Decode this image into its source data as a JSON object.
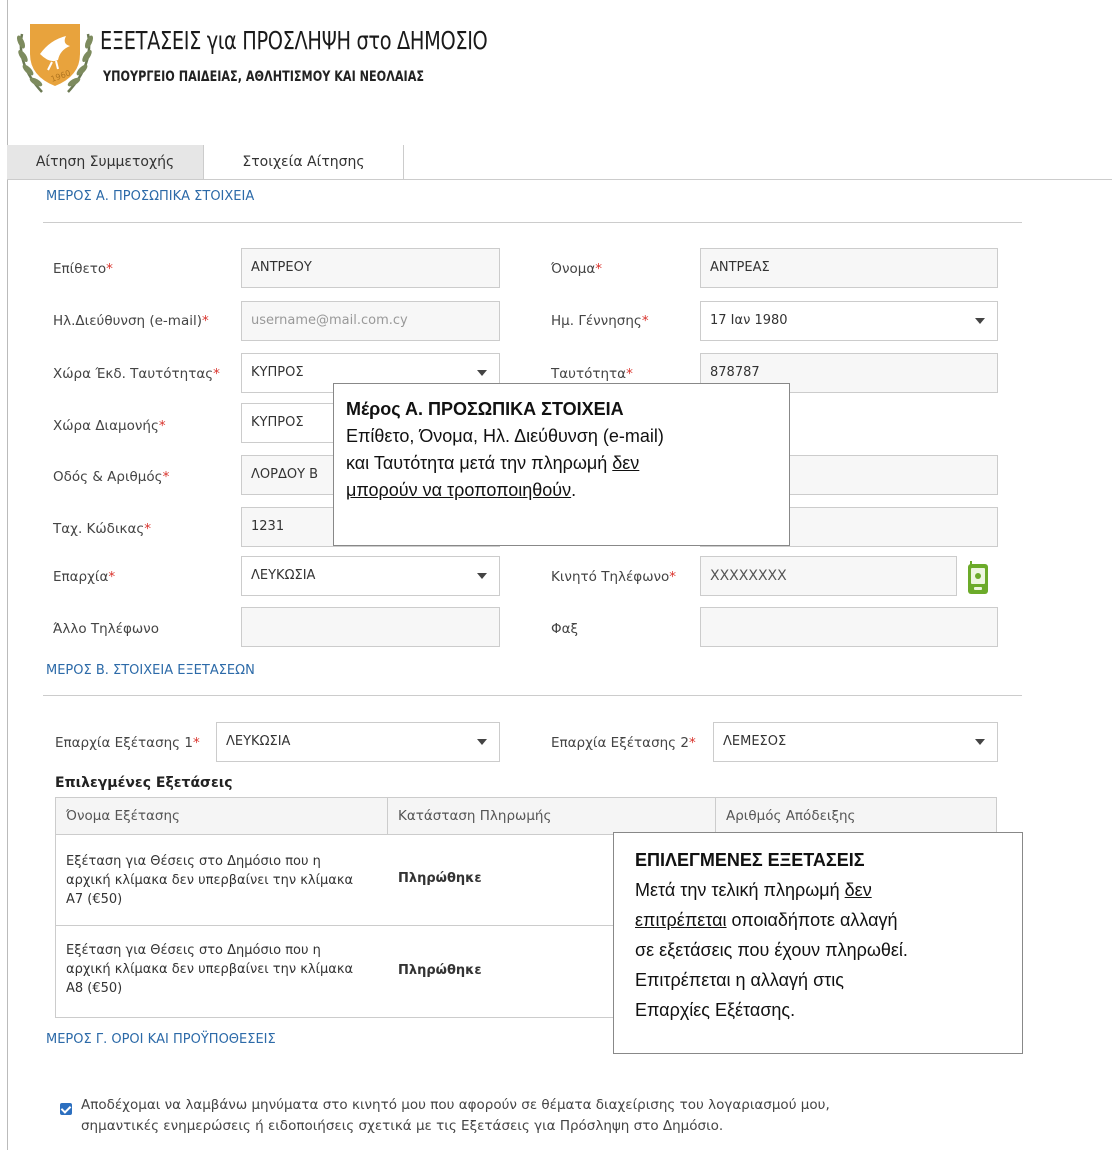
{
  "header": {
    "title": "ΕΞΕΤΑΣΕΙΣ για ΠΡΟΣΛΗΨΗ στο ΔΗΜΟΣΙΟ",
    "subtitle": "ΥΠΟΥΡΓΕΙΟ ΠΑΙΔΕΙΑΣ, ΑΘΛΗΤΙΣΜΟΥ ΚΑΙ ΝΕΟΛΑΙΑΣ"
  },
  "tabs": [
    {
      "label": "Αίτηση Συμμετοχής"
    },
    {
      "label": "Στοιχεία Αίτησης"
    }
  ],
  "section_a": {
    "title": "ΜΕΡΟΣ Α. ΠΡΟΣΩΠΙΚΑ ΣΤΟΙΧΕΙΑ",
    "fields": {
      "surname": {
        "label": "Επίθετο",
        "value": "ΑΝΤΡΕΟΥ"
      },
      "name": {
        "label": "Όνομα",
        "value": "ΑΝΤΡΕΑΣ"
      },
      "email": {
        "label": "Ηλ.Διεύθυνση (e-mail)",
        "value": "username@mail.com.cy"
      },
      "birthdate": {
        "label": "Ημ. Γέννησης",
        "value": "17 Ιαν 1980"
      },
      "id_country": {
        "label": "Χώρα Έκδ. Ταυτότητας",
        "value": "ΚΥΠΡΟΣ"
      },
      "id_number": {
        "label": "Ταυτότητα",
        "value": "878787"
      },
      "residence": {
        "label": "Χώρα Διαμονής",
        "value": "ΚΥΠΡΟΣ"
      },
      "street": {
        "label": "Οδός & Αριθμός",
        "value": "ΛΟΡΔΟΥ Β"
      },
      "postcode": {
        "label": "Ταχ. Κώδικας",
        "value": "1231"
      },
      "district": {
        "label": "Επαρχία",
        "value": "ΛΕΥΚΩΣΙΑ"
      },
      "mobile": {
        "label": "Κινητό Τηλέφωνο",
        "value": "XXXXXXXX"
      },
      "other_phone": {
        "label": "Άλλο Τηλέφωνο",
        "value": ""
      },
      "fax": {
        "label": "Φαξ",
        "value": ""
      }
    }
  },
  "tooltip_a": {
    "title": "Μέρος Α. ΠΡΟΣΩΠΙΚΑ ΣΤΟΙΧΕΙΑ",
    "line1": "Επίθετο, Όνομα, Ηλ. Διεύθυνση (e-mail)",
    "line2_pre": "και Ταυτότητα μετά την πληρωμή ",
    "line2_u": "δεν",
    "line3_u": "μπορούν να τροποποιηθούν",
    "line3_post": "."
  },
  "section_b": {
    "title": "ΜΕΡΟΣ Β. ΣΤΟΙΧΕΙΑ ΕΞΕΤΑΣΕΩΝ",
    "exam_district_1": {
      "label": "Επαρχία Εξέτασης 1",
      "value": "ΛΕΥΚΩΣΙΑ"
    },
    "exam_district_2": {
      "label": "Επαρχία Εξέτασης 2",
      "value": "ΛΕΜΕΣΟΣ"
    },
    "table_title": "Επιλεγμένες Εξετάσεις",
    "columns": [
      "Όνομα Εξέτασης",
      "Κατάσταση Πληρωμής",
      "Αριθμός Απόδειξης"
    ],
    "rows": [
      {
        "name": "Εξέταση για Θέσεις στο Δημόσιο που η αρχική κλίμακα δεν υπερβαίνει την κλίμακα Α7 (€50)",
        "status": "Πληρώθηκε"
      },
      {
        "name": "Εξέταση για Θέσεις στο Δημόσιο που η αρχική κλίμακα δεν υπερβαίνει την κλίμακα Α8 (€50)",
        "status": "Πληρώθηκε"
      }
    ]
  },
  "tooltip_b": {
    "title": "ΕΠΙΛΕΓΜΕΝΕΣ ΕΞΕΤΑΣΕΙΣ",
    "line1_pre": "Μετά την τελική πληρωμή ",
    "line1_u": "δεν",
    "line2_u": "επιτρέπεται",
    "line2_post": " οποιαδήποτε αλλαγή",
    "line3": "σε εξετάσεις που έχουν πληρωθεί.",
    "line4": "Επιτρέπεται η αλλαγή στις",
    "line5": "Επαρχίες Εξέτασης."
  },
  "section_c": {
    "title": "ΜΕΡΟΣ Γ. ΟΡΟΙ ΚΑΙ ΠΡΟΫΠΟΘΕΣΕΙΣ",
    "consent_line1": "Αποδέχομαι να λαμβάνω μηνύματα στο κινητό μου που αφορούν σε θέματα διαχείρισης του λογαριασμού μου,",
    "consent_line2": "σημαντικές ενημερώσεις ή ειδοποιήσεις σχετικά με τις Εξετάσεις για Πρόσληψη στο Δημόσιο."
  },
  "required_mark": "*",
  "colors": {
    "accent": "#2c6aa8",
    "required": "#d9322b",
    "logo": "#e8a33d"
  }
}
